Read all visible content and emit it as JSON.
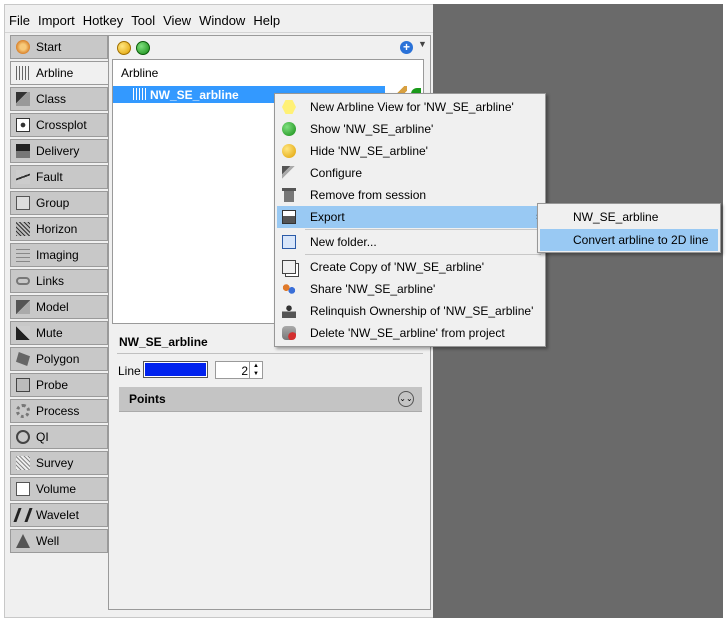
{
  "menubar": [
    "File",
    "Import",
    "Hotkey",
    "Tool",
    "View",
    "Window",
    "Help"
  ],
  "tabs": [
    {
      "label": "Start",
      "icon": "start-icon"
    },
    {
      "label": "Arbline",
      "icon": "arbline-icon"
    },
    {
      "label": "Class",
      "icon": "class-icon"
    },
    {
      "label": "Crossplot",
      "icon": "crossplot-icon"
    },
    {
      "label": "Delivery",
      "icon": "delivery-icon"
    },
    {
      "label": "Fault",
      "icon": "fault-icon"
    },
    {
      "label": "Group",
      "icon": "group-icon"
    },
    {
      "label": "Horizon",
      "icon": "horizon-icon"
    },
    {
      "label": "Imaging",
      "icon": "imaging-icon"
    },
    {
      "label": "Links",
      "icon": "links-icon"
    },
    {
      "label": "Model",
      "icon": "model-icon"
    },
    {
      "label": "Mute",
      "icon": "mute-icon"
    },
    {
      "label": "Polygon",
      "icon": "polygon-icon"
    },
    {
      "label": "Probe",
      "icon": "probe-icon"
    },
    {
      "label": "Process",
      "icon": "process-icon"
    },
    {
      "label": "QI",
      "icon": "qi-icon"
    },
    {
      "label": "Survey",
      "icon": "survey-icon"
    },
    {
      "label": "Volume",
      "icon": "volume-icon"
    },
    {
      "label": "Wavelet",
      "icon": "wavelet-icon"
    },
    {
      "label": "Well",
      "icon": "well-icon"
    }
  ],
  "active_tab": "Arbline",
  "tree": {
    "header": "Arbline",
    "selected_item": "NW_SE_arbline"
  },
  "props": {
    "title": "NW_SE_arbline",
    "line_label": "Line",
    "line_color": "#0022ee",
    "line_width": "2",
    "points_label": "Points"
  },
  "context_menu": [
    "New Arbline View for 'NW_SE_arbline'",
    "Show 'NW_SE_arbline'",
    "Hide 'NW_SE_arbline'",
    "Configure",
    "Remove from session",
    "Export",
    "New folder...",
    "Create Copy of 'NW_SE_arbline'",
    "Share 'NW_SE_arbline'",
    "Relinquish Ownership of 'NW_SE_arbline'",
    "Delete 'NW_SE_arbline' from project"
  ],
  "submenu": [
    "NW_SE_arbline",
    "Convert arbline to 2D line"
  ],
  "colors": {
    "highlight": "#99c9f3",
    "selection": "#3399ff"
  }
}
